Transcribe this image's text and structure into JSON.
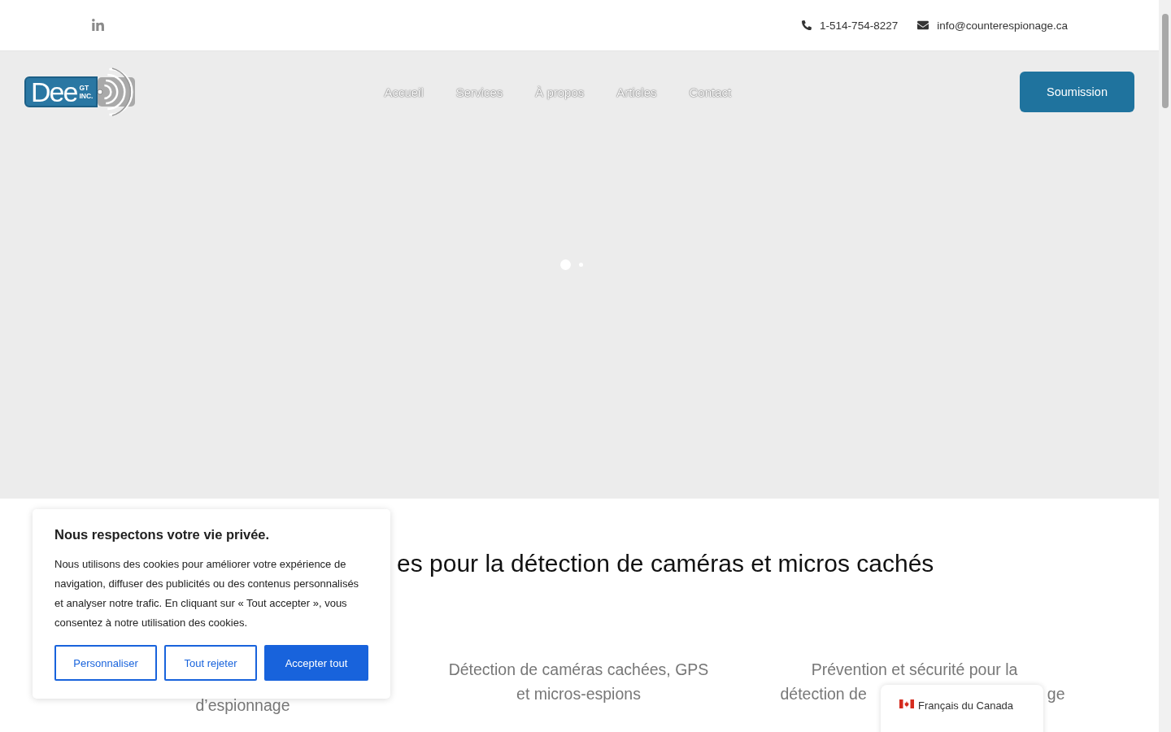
{
  "topbar": {
    "phone": "1-514-754-8227",
    "email": "info@counterespionage.ca"
  },
  "logo": {
    "wordmark": "Dee",
    "tag_top": "GT",
    "tag_bottom": "INC."
  },
  "nav": [
    {
      "label": "Accueil"
    },
    {
      "label": "Services"
    },
    {
      "label": "À propos"
    },
    {
      "label": "Articles"
    },
    {
      "label": "Contact"
    }
  ],
  "cta": "Soumission",
  "hero": {
    "slides": [
      {
        "selected": true
      },
      {
        "selected": false
      }
    ]
  },
  "section": {
    "heading_visible": "es pour la détection de caméras et micros cachés",
    "columns": [
      {
        "lines": [
          "d’espionnage"
        ]
      },
      {
        "lines": [
          "Détection de caméras cachées, GPS",
          "et micros-espions"
        ]
      },
      {
        "lines": [
          "Prévention et sécurité pour la"
        ],
        "split_line": [
          "détection de",
          "ge"
        ]
      }
    ]
  },
  "cookie_dialog": {
    "title": "Nous respectons votre vie privée.",
    "body": "Nous utilisons des cookies pour améliorer votre expérience de navigation, diffuser des publicités ou des contenus personnalisés et analyser notre trafic. En cliquant sur « Tout accepter », vous consentez à notre utilisation des cookies.",
    "buttons": [
      {
        "label": "Personnaliser",
        "kind": "outline"
      },
      {
        "label": "Tout rejeter",
        "kind": "outline"
      },
      {
        "label": "Accepter tout",
        "kind": "primary"
      }
    ]
  },
  "language": {
    "label": "Français du Canada"
  }
}
